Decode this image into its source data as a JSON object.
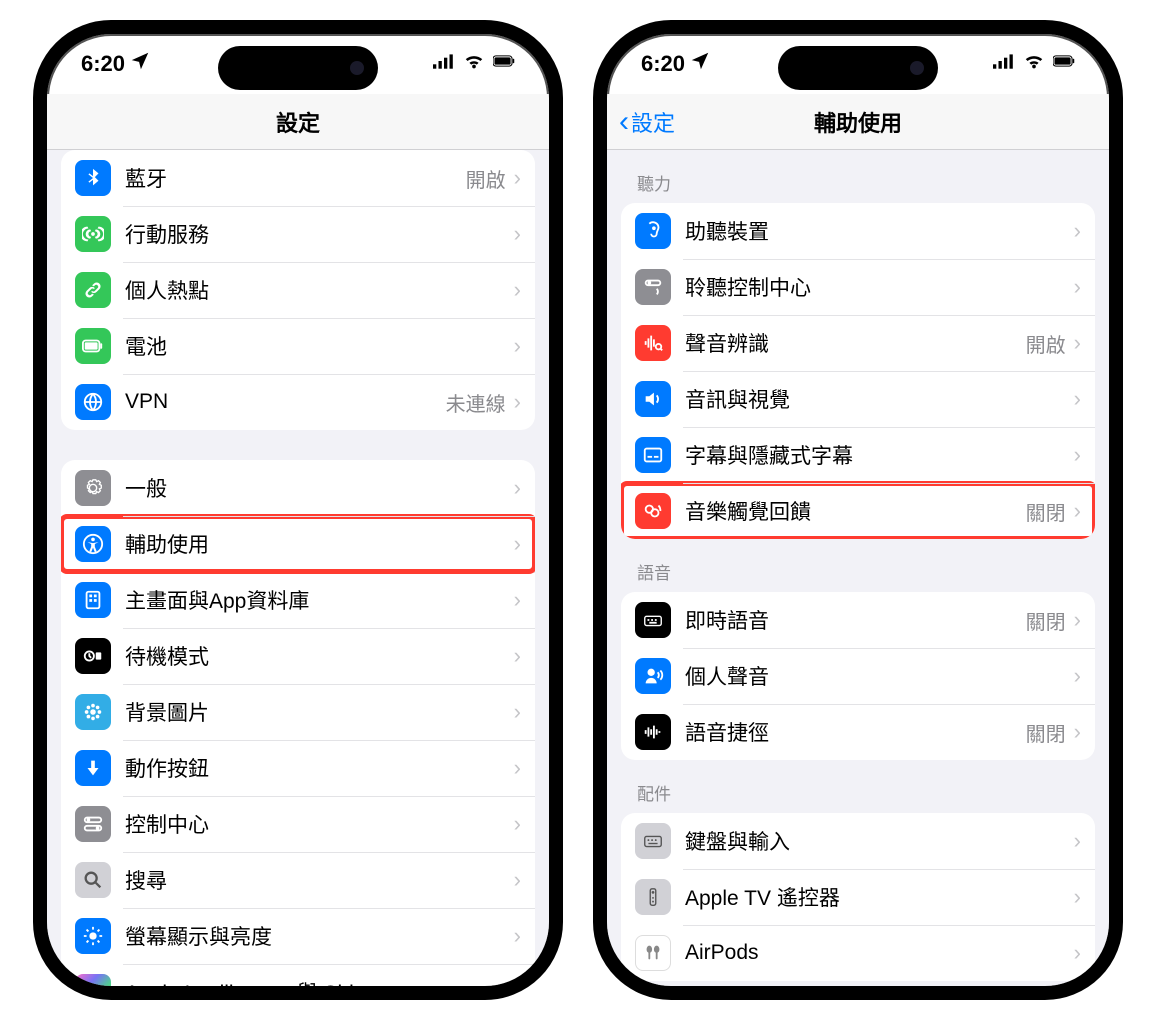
{
  "status": {
    "time": "6:20",
    "location_arrow": "➤"
  },
  "phone1": {
    "nav_title": "設定",
    "groups": [
      {
        "rows": [
          {
            "icon": "bluetooth-icon",
            "bg": "bg-blue",
            "label": "藍牙",
            "value": "開啟"
          },
          {
            "icon": "antenna-icon",
            "bg": "bg-green",
            "label": "行動服務",
            "value": ""
          },
          {
            "icon": "link-icon",
            "bg": "bg-green",
            "label": "個人熱點",
            "value": ""
          },
          {
            "icon": "battery-icon",
            "bg": "bg-green",
            "label": "電池",
            "value": ""
          },
          {
            "icon": "globe-icon",
            "bg": "bg-blue",
            "label": "VPN",
            "value": "未連線"
          }
        ]
      },
      {
        "rows": [
          {
            "icon": "gear-icon",
            "bg": "bg-grey",
            "label": "一般",
            "value": ""
          },
          {
            "icon": "accessibility-icon",
            "bg": "bg-blue",
            "label": "輔助使用",
            "value": "",
            "highlight": true
          },
          {
            "icon": "home-icon",
            "bg": "bg-blue",
            "label": "主畫面與App資料庫",
            "value": ""
          },
          {
            "icon": "standby-icon",
            "bg": "bg-black",
            "label": "待機模式",
            "value": ""
          },
          {
            "icon": "wallpaper-icon",
            "bg": "bg-cyan",
            "label": "背景圖片",
            "value": ""
          },
          {
            "icon": "action-icon",
            "bg": "bg-blue",
            "label": "動作按鈕",
            "value": ""
          },
          {
            "icon": "switches-icon",
            "bg": "bg-grey",
            "label": "控制中心",
            "value": ""
          },
          {
            "icon": "search-icon",
            "bg": "bg-greyL",
            "label": "搜尋",
            "value": ""
          },
          {
            "icon": "brightness-icon",
            "bg": "bg-blue",
            "label": "螢幕顯示與亮度",
            "value": ""
          },
          {
            "icon": "siri-icon",
            "bg": "bg-gradient",
            "label": "Apple Intelligence 與 Siri",
            "value": ""
          }
        ]
      }
    ]
  },
  "phone2": {
    "nav_back": "設定",
    "nav_title": "輔助使用",
    "sections": [
      {
        "header": "聽力",
        "rows": [
          {
            "icon": "ear-icon",
            "bg": "bg-blue",
            "label": "助聽裝置",
            "value": ""
          },
          {
            "icon": "listen-icon",
            "bg": "bg-grey",
            "label": "聆聽控制中心",
            "value": ""
          },
          {
            "icon": "sound-rec-icon",
            "bg": "bg-red",
            "label": "聲音辨識",
            "value": "開啟"
          },
          {
            "icon": "av-icon",
            "bg": "bg-blue",
            "label": "音訊與視覺",
            "value": ""
          },
          {
            "icon": "subtitle-icon",
            "bg": "bg-blue",
            "label": "字幕與隱藏式字幕",
            "value": ""
          },
          {
            "icon": "haptic-icon",
            "bg": "bg-red",
            "label": "音樂觸覺回饋",
            "value": "關閉",
            "highlight": true
          }
        ]
      },
      {
        "header": "語音",
        "rows": [
          {
            "icon": "keyboard-icon",
            "bg": "bg-black",
            "label": "即時語音",
            "value": "關閉"
          },
          {
            "icon": "voice-icon",
            "bg": "bg-blue",
            "label": "個人聲音",
            "value": ""
          },
          {
            "icon": "waveform-icon",
            "bg": "bg-black",
            "label": "語音捷徑",
            "value": "關閉"
          }
        ]
      },
      {
        "header": "配件",
        "rows": [
          {
            "icon": "keyboard2-icon",
            "bg": "bg-greyL",
            "label": "鍵盤與輸入",
            "value": ""
          },
          {
            "icon": "remote-icon",
            "bg": "bg-greyL",
            "label": "Apple TV 遙控器",
            "value": ""
          },
          {
            "icon": "airpods-icon",
            "bg": "bg-white",
            "label": "AirPods",
            "value": ""
          }
        ]
      }
    ]
  }
}
